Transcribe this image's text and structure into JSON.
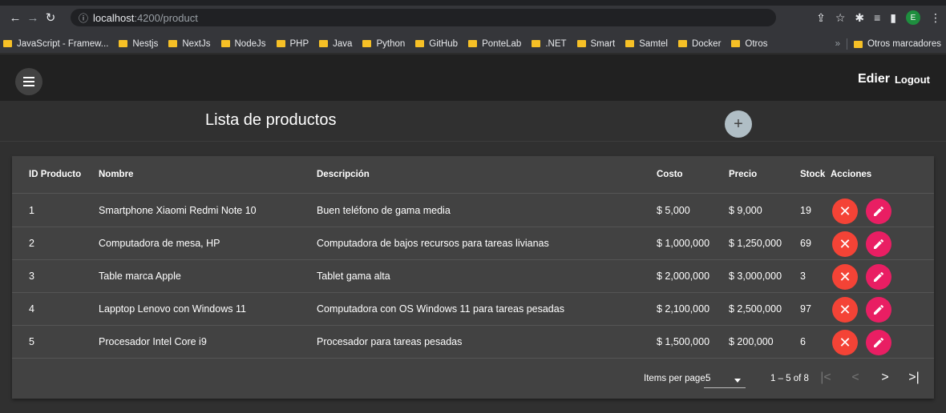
{
  "browser": {
    "url_host": "localhost",
    "url_path": ":4200/product",
    "info_icon": "ⓘ",
    "profile_initial": "E",
    "bookmarks": [
      "JavaScript - Framew...",
      "Nestjs",
      "NextJs",
      "NodeJs",
      "PHP",
      "Java",
      "Python",
      "GitHub",
      "PonteLab",
      ".NET",
      "Smart",
      "Samtel",
      "Docker",
      "Otros"
    ],
    "more_chevron": "»",
    "other_bookmarks": "Otros marcadores"
  },
  "toolbar": {
    "user_name": "Edier",
    "logout_label": "Logout"
  },
  "page": {
    "title": "Lista de productos",
    "add_symbol": "+"
  },
  "table": {
    "headers": {
      "id": "ID Producto",
      "name": "Nombre",
      "description": "Descripción",
      "cost": "Costo",
      "price": "Precio",
      "stock": "Stock",
      "actions": "Acciones"
    },
    "rows": [
      {
        "id": "1",
        "name": "Smartphone Xiaomi Redmi Note 10",
        "description": "Buen teléfono de gama media",
        "cost": "$ 5,000",
        "price": "$ 9,000",
        "stock": "19"
      },
      {
        "id": "2",
        "name": "Computadora de mesa, HP",
        "description": "Computadora de bajos recursos para tareas livianas",
        "cost": "$ 1,000,000",
        "price": "$ 1,250,000",
        "stock": "69"
      },
      {
        "id": "3",
        "name": "Table marca Apple",
        "description": "Tablet gama alta",
        "cost": "$ 2,000,000",
        "price": "$ 3,000,000",
        "stock": "3"
      },
      {
        "id": "4",
        "name": "Lapptop Lenovo con Windows 11",
        "description": "Computadora con OS Windows 11 para tareas pesadas",
        "cost": "$ 2,100,000",
        "price": "$ 2,500,000",
        "stock": "97"
      },
      {
        "id": "5",
        "name": "Procesador Intel Core i9",
        "description": "Procesador para tareas pesadas",
        "cost": "$ 1,500,000",
        "price": "$ 200,000",
        "stock": "6"
      }
    ]
  },
  "paginator": {
    "items_per_page_label": "Items per page:",
    "page_size": "5",
    "range": "1 – 5 of 8",
    "first_icon": "|<",
    "prev_icon": "<",
    "next_icon": ">",
    "last_icon": ">|"
  },
  "colors": {
    "delete_button": "#f44336",
    "edit_button": "#e91e63",
    "add_button": "#b0bec5",
    "toolbar": "#212121",
    "card": "#424242"
  }
}
